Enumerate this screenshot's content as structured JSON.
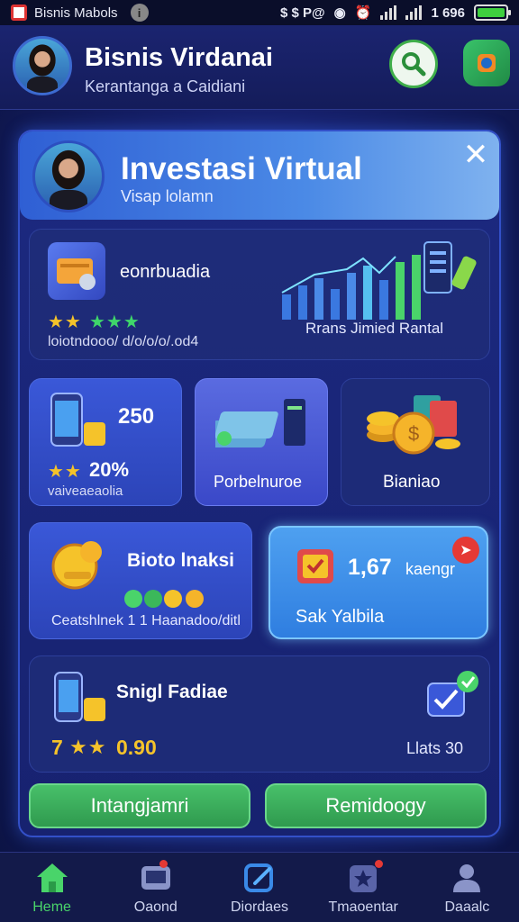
{
  "status_bar": {
    "app_title": "Bisnis Mabols",
    "indicators": "$ $ P@",
    "time": "1 696"
  },
  "header": {
    "title": "Bisnis Virdanai",
    "subtitle": "Kerantanga a Caidiani"
  },
  "banner": {
    "title": "Investasi Virtual",
    "subtitle": "Visap lolamn",
    "close_label": "✕"
  },
  "card_top": {
    "title": "eonrbuadia",
    "stars_gold": "★★",
    "stars_green": "★★★",
    "meta": "loiotndooo/ d/o/o/o/.od4",
    "chart_caption": "Rrans Jimied Rantal"
  },
  "card_stats": {
    "value": "250",
    "percent": "20%",
    "stars": "★★",
    "meta": "vaiveaeaolia"
  },
  "card_purple": {
    "label": "Porbelnuroe"
  },
  "card_coins": {
    "label": "Bianiao"
  },
  "card_bio": {
    "title": "Bioto lnaksi",
    "meta": "Ceatshlnek 1 1 Haanadoo/ditl"
  },
  "card_offer": {
    "value": "1,67",
    "unit": "kaengr",
    "label": "Sak Yalbila"
  },
  "card_bottom": {
    "title": "Snigl Fadiae",
    "rating_prefix": "7",
    "stars": "★★",
    "value": "0.90",
    "right_text": "Llats 30"
  },
  "buttons": {
    "left": "Intangjamri",
    "right": "Remidoogy"
  },
  "bottom_nav": [
    {
      "label": "Heme",
      "icon": "home-icon"
    },
    {
      "label": "Oaond",
      "icon": "screen-icon"
    },
    {
      "label": "Diordaes",
      "icon": "edit-icon"
    },
    {
      "label": "Tmaoentar",
      "icon": "badge-icon"
    },
    {
      "label": "Daaalc",
      "icon": "user-icon"
    }
  ],
  "colors": {
    "accent_green": "#49d46a",
    "star_gold": "#f5c32a",
    "panel_blue": "#1c2980"
  }
}
